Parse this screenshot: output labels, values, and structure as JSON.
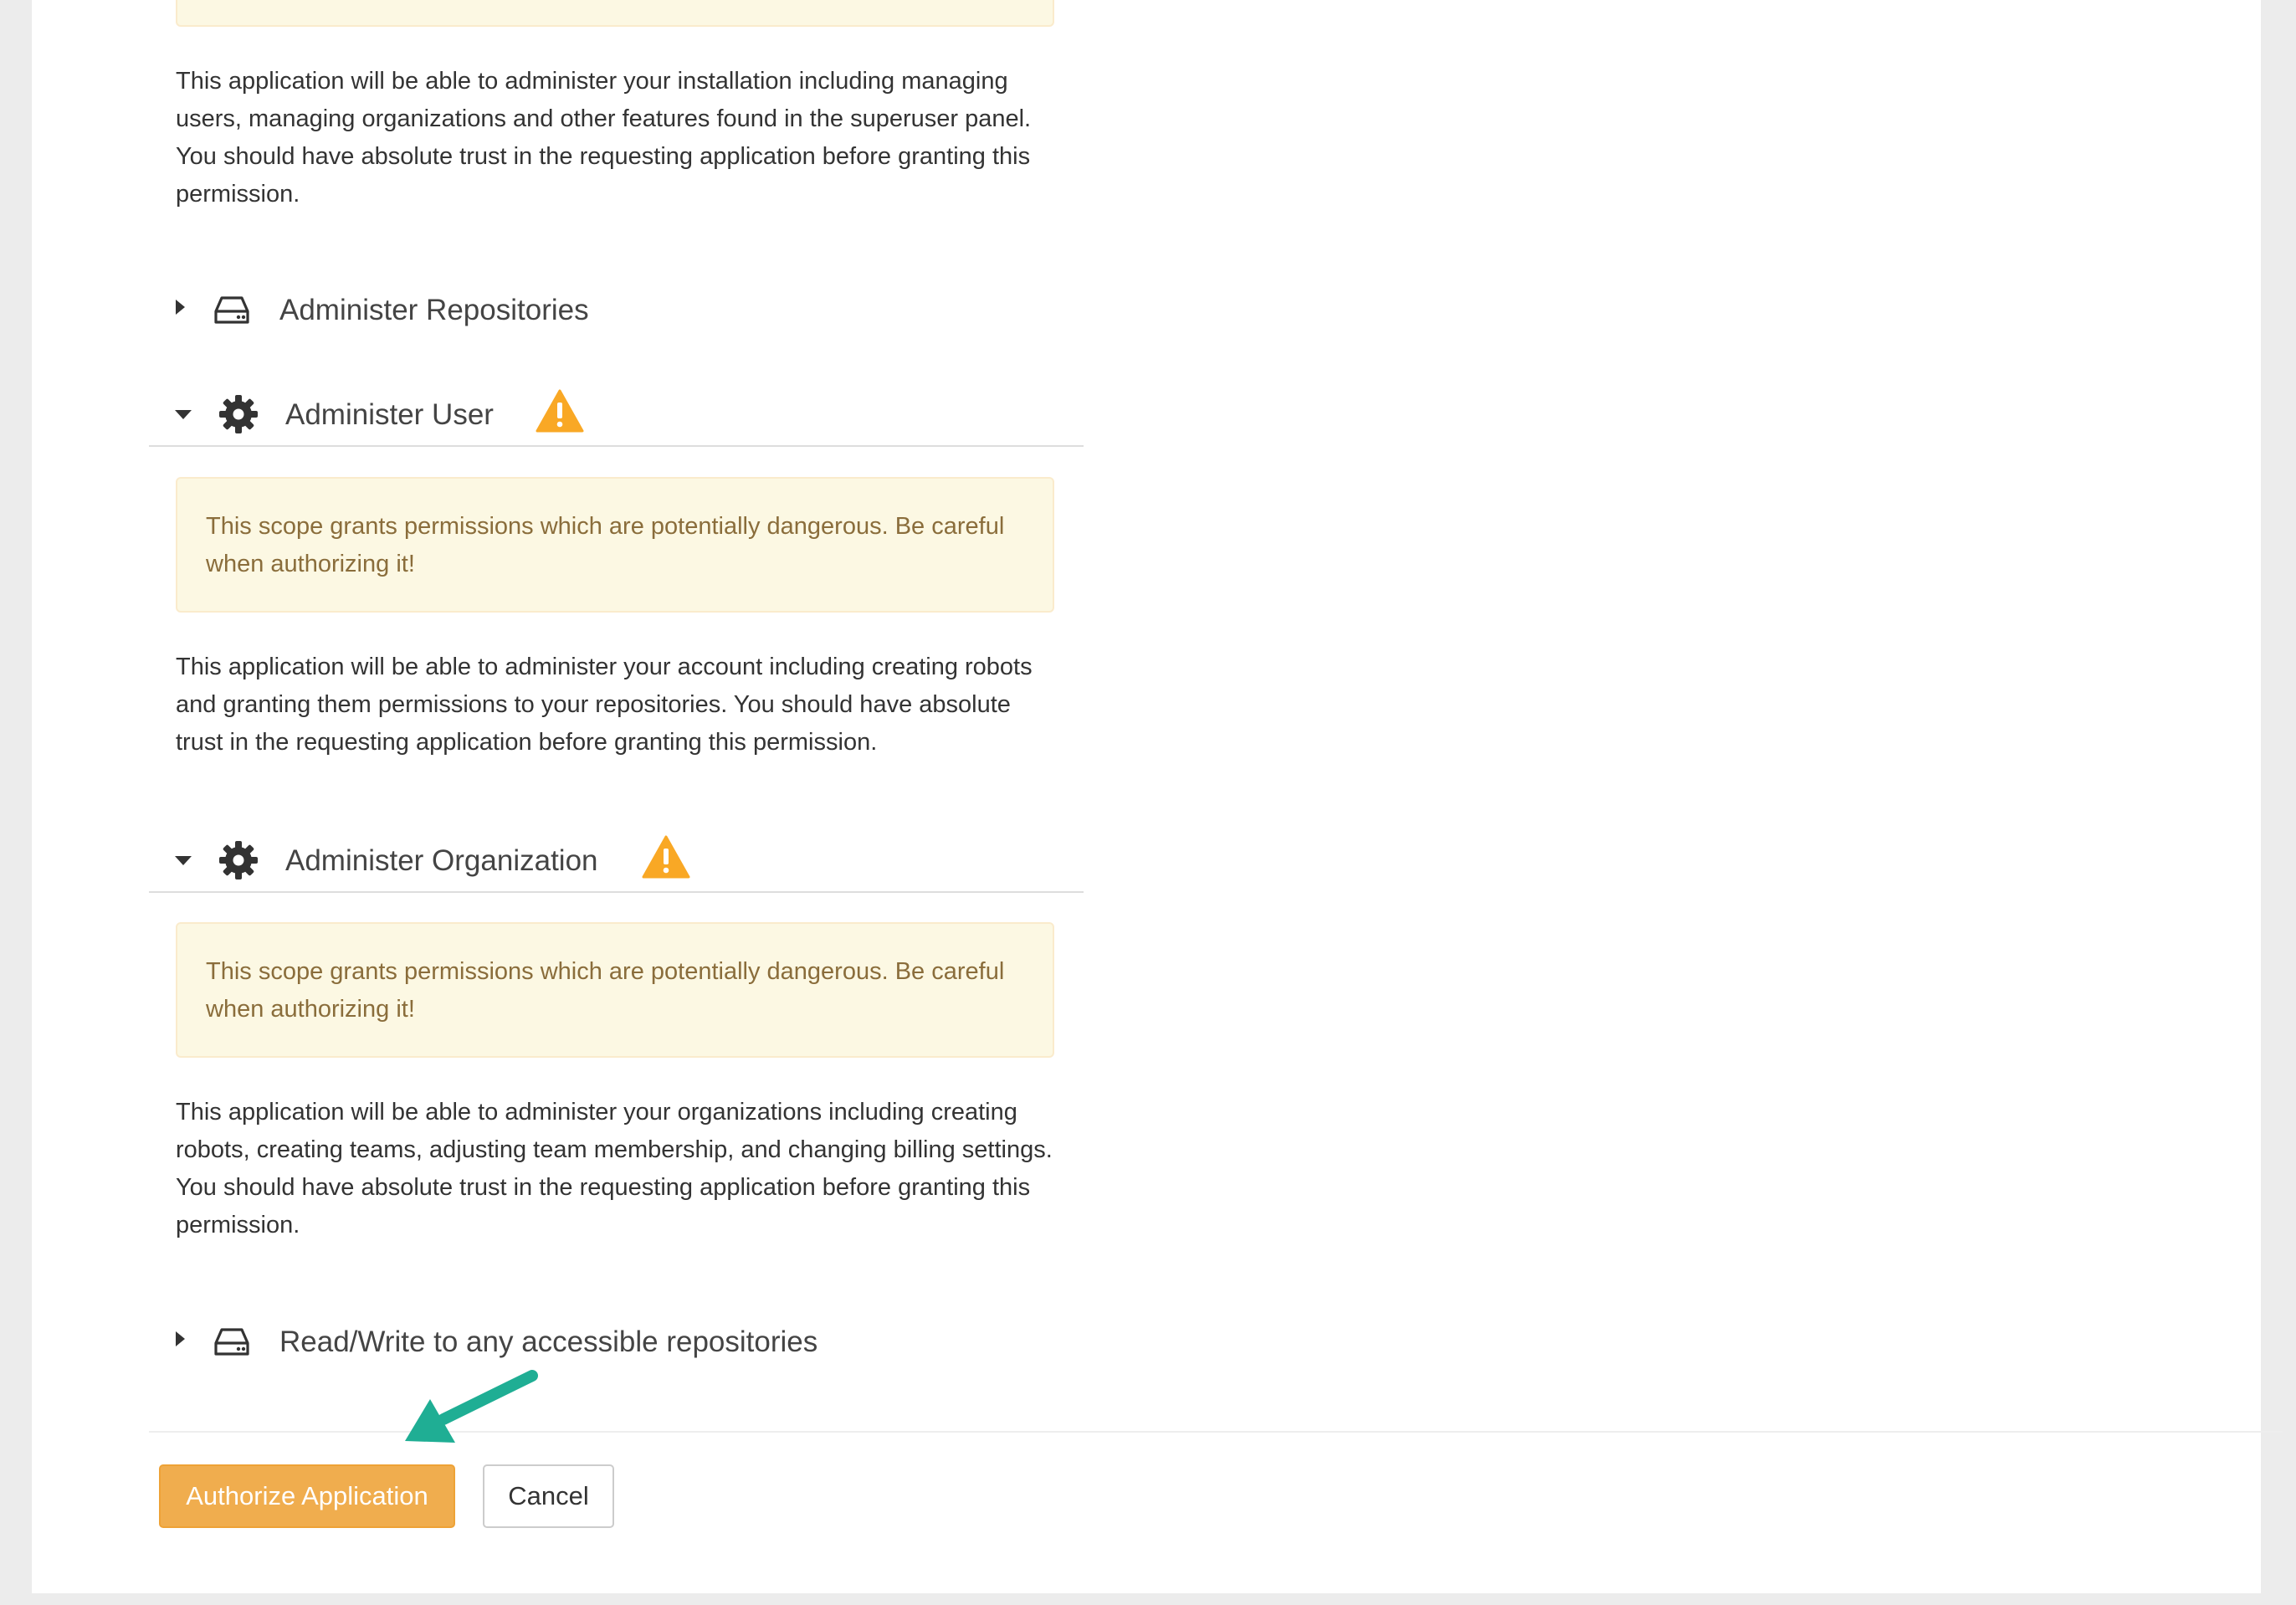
{
  "scopes": {
    "superuser": {
      "description": "This application will be able to administer your installation including managing users, managing organizations and other features found in the superuser panel. You should have absolute trust in the requesting application before granting this permission."
    },
    "admin_repo": {
      "title": "Administer Repositories"
    },
    "admin_user": {
      "title": "Administer User",
      "warning": "This scope grants permissions which are potentially dangerous. Be careful when authorizing it!",
      "description": "This application will be able to administer your account including creating robots and granting them permissions to your repositories. You should have absolute trust in the requesting application before granting this permission."
    },
    "admin_org": {
      "title": "Administer Organization",
      "warning": "This scope grants permissions which are potentially dangerous. Be careful when authorizing it!",
      "description": "This application will be able to administer your organizations including creating robots, creating teams, adjusting team membership, and changing billing settings. You should have absolute trust in the requesting application before granting this permission."
    },
    "repo_write": {
      "title": "Read/Write to any accessible repositories"
    }
  },
  "actions": {
    "authorize_label": "Authorize Application",
    "cancel_label": "Cancel"
  },
  "colors": {
    "warning_icon": "#f9a825",
    "annotation_arrow": "#1fae94",
    "authorize_button": "#f0ad4e"
  },
  "icons": {
    "repo": "hdd-icon",
    "admin": "gear-icon",
    "danger": "warning-triangle-icon"
  }
}
